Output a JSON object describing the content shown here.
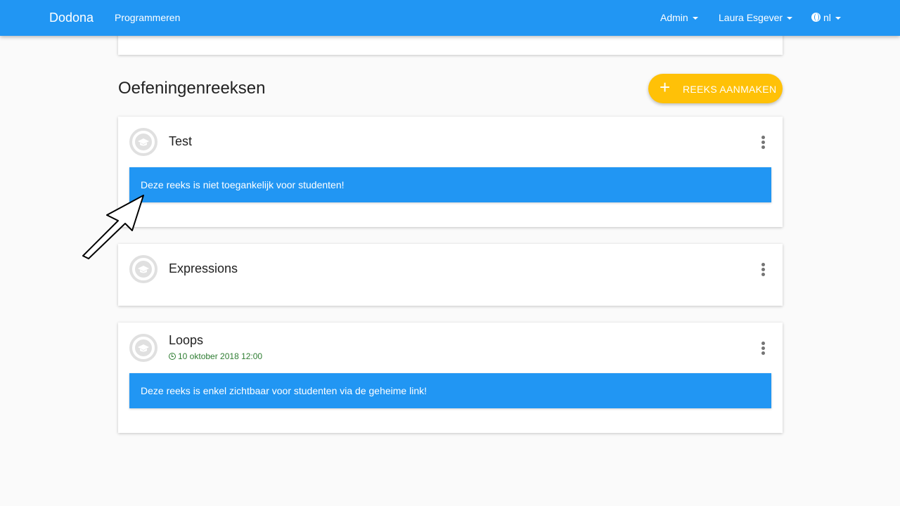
{
  "navbar": {
    "brand": "Dodona",
    "nav_programmeren": "Programmeren",
    "admin": "Admin",
    "user": "Laura Esgever",
    "language": "nl"
  },
  "section": {
    "title": "Oefeningenreeksen",
    "add_button": "REEKS AANMAKEN"
  },
  "series": [
    {
      "title": "Test",
      "alert": "Deze reeks is niet toegankelijk voor studenten!"
    },
    {
      "title": "Expressions"
    },
    {
      "title": "Loops",
      "deadline": "10 oktober 2018 12:00",
      "alert": "Deze reeks is enkel zichtbaar voor studenten via de geheime link!"
    }
  ],
  "colors": {
    "primary": "#2196f3",
    "accent": "#ffc107",
    "deadline": "#2e7d32"
  }
}
